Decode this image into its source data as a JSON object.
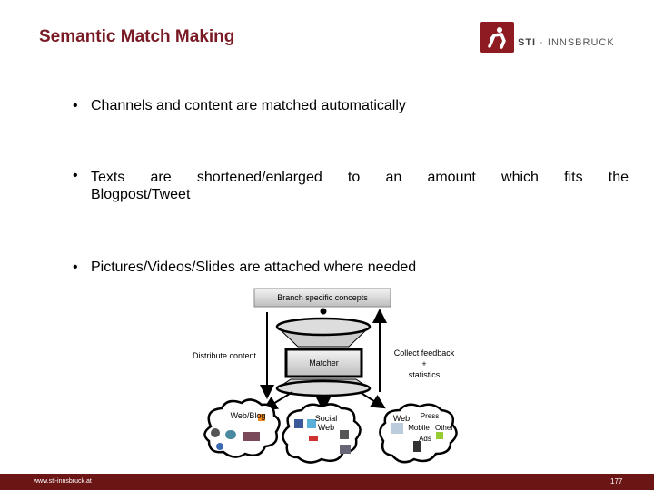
{
  "header": {
    "title": "Semantic Match Making",
    "logo_text_bold": "STI",
    "logo_text_rest": " · INNSBRUCK",
    "brand_color": "#7a1a24"
  },
  "bullets": [
    {
      "text": "Channels and content are matched automatically"
    },
    {
      "text_line1": "Texts are shortened/enlarged to an amount which fits the",
      "text_line2": "Blogpost/Tweet"
    },
    {
      "text": "Pictures/Videos/Slides are attached where needed"
    }
  ],
  "bullet_glyph": "•",
  "diagram": {
    "top_box": "Branch specific concepts",
    "center_box": "Matcher",
    "left_label": "Distribute content",
    "right_label_1": "Collect feedback",
    "right_label_2": "+",
    "right_label_3": "statistics",
    "clouds": [
      {
        "label": "Web/Blog"
      },
      {
        "label": "Social Web"
      },
      {
        "label": "Web",
        "extra": [
          "Press",
          "Mobile",
          "Other",
          "Ads"
        ]
      }
    ]
  },
  "footer": {
    "url": "www.sti-innsbruck.at",
    "page_number": "177",
    "color": "#6b1515"
  }
}
